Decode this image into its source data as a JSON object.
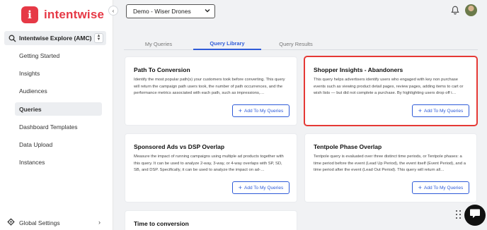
{
  "brand": {
    "name": "intentwise",
    "mark": "i"
  },
  "sidebar": {
    "explore_label": "Intentwise Explore (AMC)",
    "items": [
      {
        "label": "Getting Started"
      },
      {
        "label": "Insights"
      },
      {
        "label": "Audiences"
      },
      {
        "label": "Queries"
      },
      {
        "label": "Dashboard Templates"
      },
      {
        "label": "Data Upload"
      },
      {
        "label": "Instances"
      }
    ],
    "active_item": "Queries",
    "global_settings_label": "Global Settings"
  },
  "header": {
    "account_selected": "Demo - Wiser Drones"
  },
  "tabs": [
    {
      "label": "My Queries"
    },
    {
      "label": "Query Library"
    },
    {
      "label": "Query Results"
    }
  ],
  "active_tab": "Query Library",
  "cards": [
    {
      "title": "Path To Conversion",
      "description": "Identify the most popular path(s) your customers took before converting. This query will return the campaign path users took, the number of path occurrences, and the performance metrics associated with each path, such as impressions,…",
      "button_label": "Add To My Queries"
    },
    {
      "title": "Shopper Insights - Abandoners",
      "description": "This query helps advertisers identify users who engaged with key non purchase events such as viewing product detail pages, review pages, adding items to cart or wish lists — but did not complete a purchase. By highlighting users drop off i…",
      "button_label": "Add To My Queries"
    },
    {
      "title": "Sponsored Ads vs DSP Overlap",
      "description": "Measure the impact of running campaigns using multiple ad products together with this query. It can be used to analyze 2-way, 3-way, or 4-way overlaps with SP, SD, SB, and DSP. Specifically, it can be used to analyze the impact on ad-…",
      "button_label": "Add To My Queries"
    },
    {
      "title": "Tentpole Phase Overlap",
      "description": "Tentpole query is evaluated over three distinct time periods, or Tentpole phases: a time period before the event (Lead Up Period), the event itself (Event Period), and a time period after the event (Lead Out Period). This query will return all…",
      "button_label": "Add To My Queries"
    },
    {
      "title": "Time to conversion",
      "description": "",
      "button_label": ""
    }
  ],
  "colors": {
    "brand": "#e63946",
    "accent": "#2e5bd8",
    "highlight": "#e53935"
  }
}
